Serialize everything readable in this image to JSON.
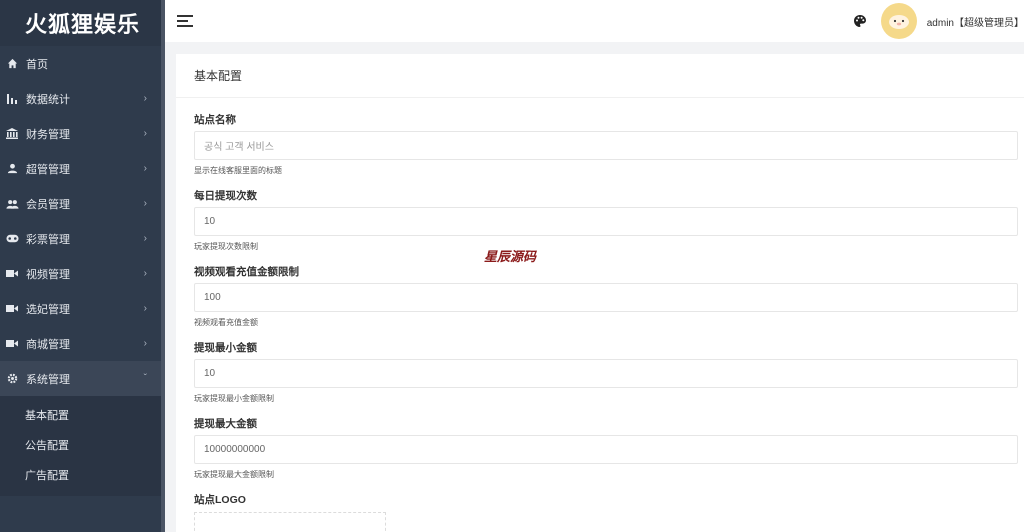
{
  "brand": {
    "title": "火狐狸娱乐"
  },
  "sidebar": {
    "items": [
      {
        "label": "首页",
        "icon": "home-icon",
        "has_arrow": false
      },
      {
        "label": "数据统计",
        "icon": "bar-chart-icon",
        "has_arrow": true
      },
      {
        "label": "财务管理",
        "icon": "bank-icon",
        "has_arrow": true
      },
      {
        "label": "超管管理",
        "icon": "user-icon",
        "has_arrow": true
      },
      {
        "label": "会员管理",
        "icon": "users-icon",
        "has_arrow": true
      },
      {
        "label": "彩票管理",
        "icon": "gamepad-icon",
        "has_arrow": true
      },
      {
        "label": "视频管理",
        "icon": "video-icon",
        "has_arrow": true
      },
      {
        "label": "选妃管理",
        "icon": "video-icon",
        "has_arrow": true
      },
      {
        "label": "商城管理",
        "icon": "video-icon",
        "has_arrow": true
      },
      {
        "label": "系统管理",
        "icon": "gear-icon",
        "has_arrow": true,
        "expanded": true
      }
    ],
    "arrow": "›",
    "arrow_down": "ˇ",
    "submenu": [
      "基本配置",
      "公告配置",
      "广告配置"
    ]
  },
  "header": {
    "user_name": "admin【超级管理员】",
    "avatar_color": "#f5d98a"
  },
  "content": {
    "card_title": "基本配置",
    "fields": [
      {
        "label": "站点名称",
        "value": "공식 고객 서비스",
        "placeholder": true,
        "help": "显示在线客服里面的标题"
      },
      {
        "label": "每日提现次数",
        "value": "10",
        "placeholder": false,
        "help": "玩家提现次数限制"
      },
      {
        "label": "视频观看充值金额限制",
        "value": "100",
        "placeholder": false,
        "help": "视频观看充值金额"
      },
      {
        "label": "提现最小金额",
        "value": "10",
        "placeholder": false,
        "help": "玩家提现最小金额限制"
      },
      {
        "label": "提现最大金额",
        "value": "10000000000",
        "placeholder": false,
        "help": "玩家提现最大金额限制"
      }
    ],
    "logo_label": "站点LOGO",
    "watermark": "星辰源码"
  },
  "colors": {
    "sidebar_bg": "#2f3b4c",
    "upload_accent": "#5bb8a8",
    "watermark": "#8b1b1b"
  }
}
